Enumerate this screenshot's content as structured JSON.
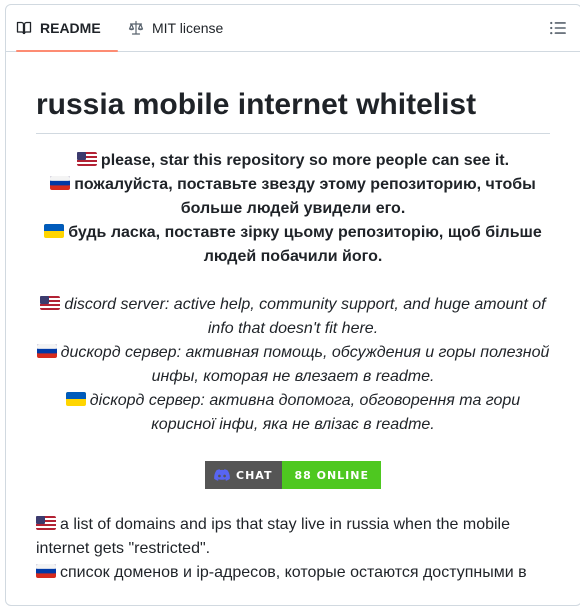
{
  "tabs": {
    "readme": "README",
    "license": "MIT license"
  },
  "title": "russia mobile internet whitelist",
  "star_lines": [
    {
      "flag": "us",
      "text": "please, star this repository so more people can see it."
    },
    {
      "flag": "ru",
      "text": "пожалуйста, поставьте звезду этому репозиторию, чтобы больше людей увидели его."
    },
    {
      "flag": "ua",
      "text": "будь ласка, поставте зірку цьому репозиторію, щоб більше людей побачили його."
    }
  ],
  "discord_lines": [
    {
      "flag": "us",
      "text": "discord server: active help, community support, and huge amount of info that doesn't fit here."
    },
    {
      "flag": "ru",
      "text": "дискорд сервер: активная помощь, обсуждения и горы полезной инфы, которая не влезает в readme."
    },
    {
      "flag": "ua",
      "text": "діскорд сервер: активна допомога, обговорення та гори корисної інфи, яка не влізає в readme."
    }
  ],
  "badge": {
    "label": "CHAT",
    "value": "88 ONLINE",
    "left_color": "#555555",
    "right_color": "#4ec820"
  },
  "body_lines": [
    {
      "flag": "us",
      "text": "a list of domains and ips that stay live in russia when the mobile internet gets \"restricted\"."
    },
    {
      "flag": "ru",
      "text": "список доменов и ip-адресов, которые остаются доступными в"
    }
  ]
}
